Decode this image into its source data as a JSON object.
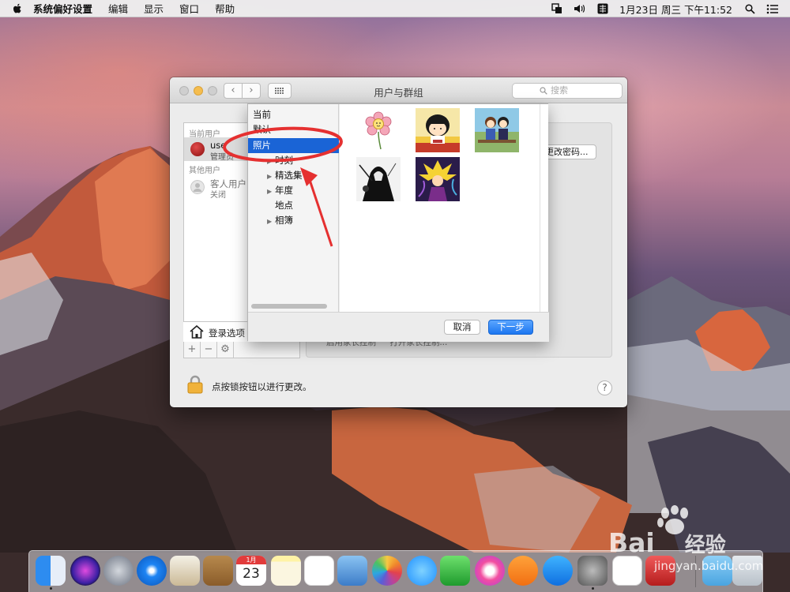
{
  "menubar": {
    "app_name": "系统偏好设置",
    "items": [
      "编辑",
      "显示",
      "窗口",
      "帮助"
    ],
    "clock": "1月23日 周三 下午11:52"
  },
  "window": {
    "title": "用户与群组",
    "search_placeholder": "搜索",
    "users_pane": {
      "current_header": "当前用户",
      "current_user": {
        "name": "use",
        "role": "管理员"
      },
      "other_header": "其他用户",
      "guest_user": {
        "name": "客人用户",
        "status": "关闭"
      },
      "login_options": "登录选项",
      "add": "+",
      "remove": "−",
      "gear": "⚙"
    },
    "change_password": "更改密码...",
    "parental_controls_label": "启用家长控制",
    "open_parental_controls": "打开家长控制...",
    "lock_text": "点按锁按钮以进行更改。",
    "help": "?"
  },
  "sheet": {
    "sources": [
      {
        "label": "当前",
        "expandable": false,
        "indent": false
      },
      {
        "label": "默认",
        "expandable": false,
        "indent": false
      },
      {
        "label": "照片",
        "expandable": false,
        "indent": false,
        "selected": true
      },
      {
        "label": "时刻",
        "expandable": true,
        "indent": true
      },
      {
        "label": "精选集",
        "expandable": true,
        "indent": true
      },
      {
        "label": "年度",
        "expandable": true,
        "indent": true
      },
      {
        "label": "地点",
        "expandable": false,
        "indent": true
      },
      {
        "label": "相簿",
        "expandable": true,
        "indent": true
      }
    ],
    "photos": [
      "flower",
      "chibi-maruko",
      "anime-couple",
      "dark-warrior",
      "super-saiyan"
    ],
    "cancel": "取消",
    "next": "下一步"
  },
  "dock": {
    "apps": [
      "Finder",
      "Siri",
      "Launchpad",
      "Safari",
      "Mail",
      "Contacts",
      "Calendar",
      "Notes",
      "Reminders",
      "Preview",
      "Photos",
      "Messages",
      "FaceTime",
      "iTunes",
      "iBooks",
      "App Store",
      "System Preferences",
      "Mail Composer",
      "Other",
      "Downloads",
      "Trash"
    ],
    "calendar_month": "1月",
    "calendar_day": "23"
  },
  "watermark": {
    "brand": "Bai",
    "brand_cn": "经验",
    "url": "jingyan.baidu.com"
  },
  "colors": {
    "selection": "#1a64d6",
    "primary_button": "#1c76f0",
    "annotation": "#e53030"
  }
}
